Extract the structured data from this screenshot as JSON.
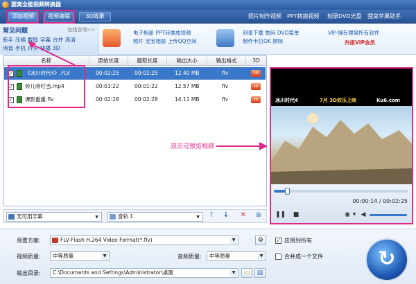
{
  "app": {
    "title": "狸窝全能视频转换器"
  },
  "tabs": [
    {
      "label": "添加视频"
    },
    {
      "label": "视频编辑"
    },
    {
      "label": "3D效果"
    }
  ],
  "top_links": [
    "照片制作视频",
    "PPT转换视频",
    "刻录DVD光盘",
    "狸窝苹果助手"
  ],
  "faq": {
    "title": "常见问题",
    "online": "在线咨询>>",
    "row1": [
      "新手",
      "压缩",
      "截取",
      "字幕",
      "合并",
      "高清"
    ],
    "row2": [
      "消音",
      "手机",
      "片头",
      "快播",
      "3D"
    ]
  },
  "promos": {
    "ppt_line1": "电子相册  PPT转换成视频",
    "ppt_line2": "照片  宝宝相册  上传QQ空间",
    "dvd_line1": "刻录下载  数码  DVD菜单",
    "dvd_line2": "制作卡拉OK  擦除",
    "vip_line1": "VIP-拥有狸窝所有软件",
    "vip_line2": "升级VIP会员"
  },
  "table": {
    "columns": [
      "名称",
      "原始长度",
      "截取长度",
      "输出大小",
      "输出格式",
      "3D"
    ],
    "rows": [
      {
        "name": "《冰川时代4》.FLV",
        "orig": "00:02:25",
        "clip": "00:02:25",
        "size": "12.40 MB",
        "format": "flv",
        "checked": true,
        "selected": true
      },
      {
        "name": "铃儿响叮当.mp4",
        "orig": "00:01:22",
        "clip": "00:01:22",
        "size": "12.57 MB",
        "format": "flv",
        "checked": true,
        "selected": false
      },
      {
        "name": "课影重重.flv",
        "orig": "00:02:28",
        "clip": "00:02:28",
        "size": "14.11 MB",
        "format": "flv",
        "checked": true,
        "selected": false
      }
    ]
  },
  "listbar": {
    "subtitle": "无可用字幕",
    "audio": "音轨 1"
  },
  "annotation": "双击可预览视频",
  "preview": {
    "overlay_title": "冰川时代4",
    "overlay_date": "7月 3D欢乐上映",
    "overlay_brand": "Ku6.com",
    "current_time": "00:00:14",
    "total_time": "00:02:25",
    "time_separator": " / ",
    "progress": 0.1
  },
  "settings": {
    "preset_label": "预置方案:",
    "preset_value": "FLV-Flash H.264 Video Format(*.flv)",
    "video_quality_label": "视频质量:",
    "video_quality_value": "中等质量",
    "audio_quality_label": "音频质量:",
    "audio_quality_value": "中等质量",
    "apply_all_label": "应用到所有",
    "merge_label": "合并成一个文件",
    "output_label": "输出目录:",
    "output_value": "C:\\Documents and Settings\\Administrator\\桌面"
  },
  "colors": {
    "accent": "#e0288b",
    "brand": "#2c5aa0",
    "selection": "#3a78c9"
  }
}
